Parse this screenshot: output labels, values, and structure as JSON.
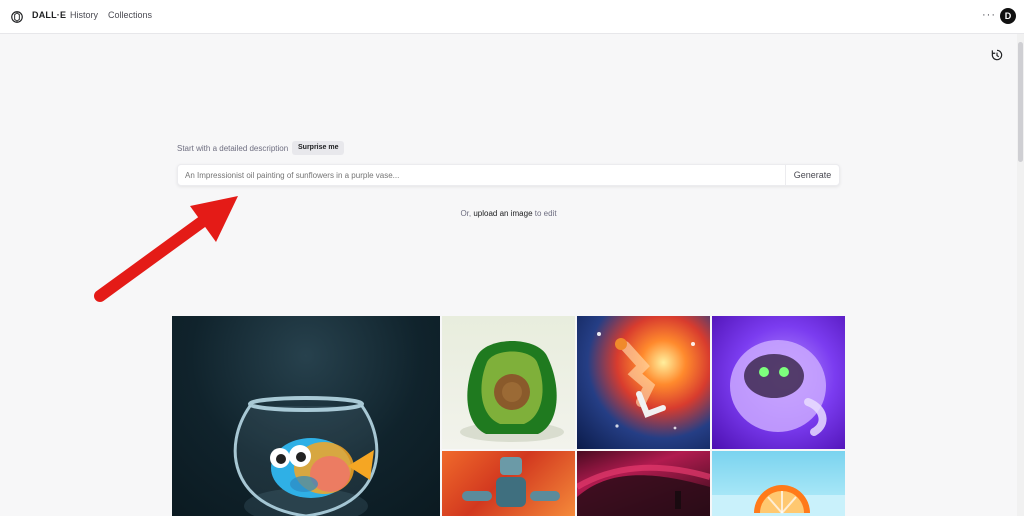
{
  "header": {
    "brand": "DALL·E",
    "nav": {
      "history": "History",
      "collections": "Collections"
    },
    "more_label": "···",
    "avatar_letter": "D",
    "icons": {
      "logo": "openai-logo-icon",
      "more": "more-icon",
      "history": "history-icon"
    }
  },
  "prompt": {
    "label": "Start with a detailed description",
    "surprise_button": "Surprise me",
    "input_placeholder": "An Impressionist oil painting of sunflowers in a purple vase...",
    "generate_button": "Generate",
    "upload": {
      "prefix": "Or,",
      "link": "upload an image",
      "suffix": "to edit"
    }
  },
  "gallery": {
    "tiles": [
      {
        "name": "fish-bowl-image"
      },
      {
        "name": "avocado-chair-image"
      },
      {
        "name": "space-basketball-image"
      },
      {
        "name": "purple-monster-image"
      },
      {
        "name": "robot-painting-image"
      },
      {
        "name": "abstract-red-image"
      },
      {
        "name": "orange-slice-image"
      }
    ]
  },
  "colors": {
    "page_bg": "#f7f7f8",
    "header_bg": "#ffffff",
    "arrow_red": "#e41b17"
  }
}
